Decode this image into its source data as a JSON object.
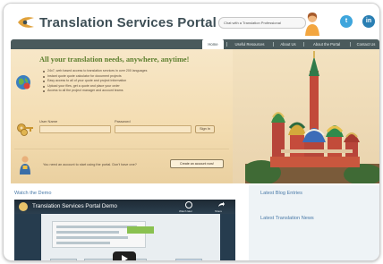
{
  "header": {
    "logo_text": "Translation Services Portal",
    "chat_prompt": "Chat with a Translation Professional",
    "social": {
      "twitter": "t",
      "linkedin": "in"
    }
  },
  "nav": {
    "items": [
      {
        "label": "Home",
        "active": true
      },
      {
        "label": "Useful Resources",
        "active": false
      },
      {
        "label": "About Us",
        "active": false
      },
      {
        "label": "About the Portal",
        "active": false
      },
      {
        "label": "Contact Us",
        "active": false
      }
    ]
  },
  "hero": {
    "title": "All your translation needs, anywhere, anytime!",
    "bullets": [
      "24x7, web based access to translation services in over 200 languages",
      "Instant quote quote calculator for document projects",
      "Easy access to all of your quote and project information",
      "Upload your files, get a quote and place your order",
      "Access to all the project manager and account teams"
    ],
    "login": {
      "username_label": "User Name",
      "password_label": "Password",
      "signin_label": "Sign In",
      "username_value": "",
      "password_value": ""
    },
    "account_prompt": "You need an account to start using the portal. Don't have one?",
    "create_account_label": "Create an account now!"
  },
  "lower": {
    "watch_title": "Watch the Demo",
    "video": {
      "title": "Translation Services Portal Demo",
      "watch_later": "Watch later",
      "share": "Share"
    },
    "blog_title": "Latest Blog Entries",
    "news_title": "Latest Translation News"
  },
  "colors": {
    "nav_bg": "#4a5a5c",
    "hero_title": "#5f8030",
    "section_title": "#4a7aa8"
  }
}
